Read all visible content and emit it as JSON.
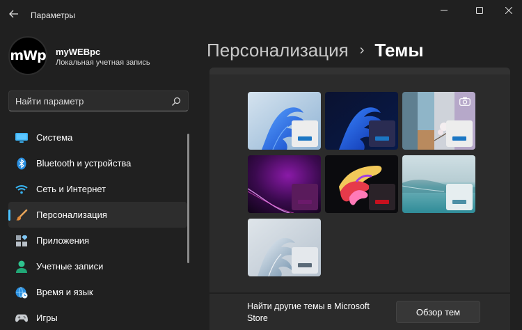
{
  "window": {
    "title": "Параметры"
  },
  "profile": {
    "avatar_text": "mWp",
    "name": "myWEBpc",
    "account_type": "Локальная учетная запись"
  },
  "search": {
    "placeholder": "Найти параметр"
  },
  "sidebar": {
    "items": [
      {
        "label": "Система",
        "icon": "monitor-icon",
        "active": false
      },
      {
        "label": "Bluetooth и устройства",
        "icon": "bluetooth-icon",
        "active": false
      },
      {
        "label": "Сеть и Интернет",
        "icon": "wifi-icon",
        "active": false
      },
      {
        "label": "Персонализация",
        "icon": "brush-icon",
        "active": true
      },
      {
        "label": "Приложения",
        "icon": "apps-icon",
        "active": false
      },
      {
        "label": "Учетные записи",
        "icon": "person-icon",
        "active": false
      },
      {
        "label": "Время и язык",
        "icon": "globe-clock-icon",
        "active": false
      },
      {
        "label": "Игры",
        "icon": "gamepad-icon",
        "active": false
      }
    ]
  },
  "header": {
    "parent": "Персонализация",
    "separator": "›",
    "current": "Темы"
  },
  "themes": [
    {
      "name": "windows-light",
      "bar_color": "#1b76c4",
      "window_color": "#ededed"
    },
    {
      "name": "windows-dark",
      "bar_color": "#1b76c4",
      "window_color": "#2a2c52"
    },
    {
      "name": "spotlight",
      "bar_color": "#1b76c4",
      "window_color": "#ededed",
      "camera_icon": true
    },
    {
      "name": "glow",
      "bar_color": "#6b1a6b",
      "window_color": "#5a1b5c"
    },
    {
      "name": "captured-motion",
      "bar_color": "#c8101e",
      "window_color": "#2a2228"
    },
    {
      "name": "flow",
      "bar_color": "#4d8fa6",
      "window_color": "#e6eef0"
    },
    {
      "name": "sunrise",
      "bar_color": "#5a6a78",
      "window_color": "#e4e8ec"
    }
  ],
  "footer": {
    "text": "Найти другие темы в Microsoft Store",
    "button": "Обзор тем"
  },
  "colors": {
    "accent": "#4cc2ff",
    "background": "#202020",
    "card": "#2b2b2b"
  }
}
